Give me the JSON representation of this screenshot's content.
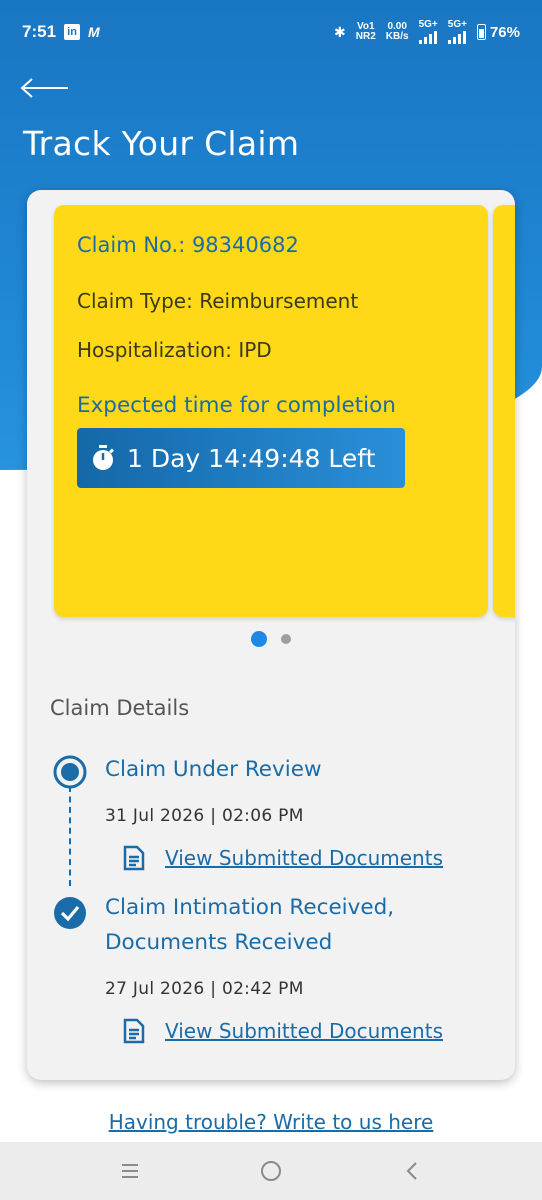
{
  "status_bar": {
    "time": "7:51",
    "left_icons": [
      "linkedin-icon",
      "m-app-icon"
    ],
    "linkedin_glyph": "in",
    "m_glyph": "M",
    "bluetooth_glyph": "✱",
    "volte_top": "Vo1",
    "volte_bottom": "NR2",
    "speed_top": "0.00",
    "speed_bottom": "KB/s",
    "sim1_label": "5G+",
    "sim2_label": "5G+",
    "battery": "76%"
  },
  "header": {
    "title": "Track Your Claim"
  },
  "claim_card": {
    "claim_no": "Claim No.: 98340682",
    "claim_type": "Claim Type: Reimbursement",
    "hospitalization": "Hospitalization: IPD",
    "expected_label": "Expected time for completion",
    "timer_text": "1 Day 14:49:48 Left",
    "card_color": "#ffd817"
  },
  "pager": {
    "active_index": 0,
    "count": 2
  },
  "claim_details": {
    "title": "Claim Details",
    "timeline": [
      {
        "status_line1": "Claim Under Review",
        "status_line2": "",
        "date": "31 Jul 2026 | 02:06 PM",
        "link": "View Submitted Documents",
        "state": "current"
      },
      {
        "status_line1": "Claim Intimation Received,",
        "status_line2": "Documents Received",
        "date": "27 Jul 2026 | 02:42 PM",
        "link": "View Submitted Documents",
        "state": "done"
      }
    ]
  },
  "footer": {
    "trouble_link": "Having trouble? Write to us here"
  },
  "colors": {
    "primary_blue": "#1a6ca8",
    "header_blue": "#1976c2",
    "accent_yellow": "#ffd817"
  }
}
